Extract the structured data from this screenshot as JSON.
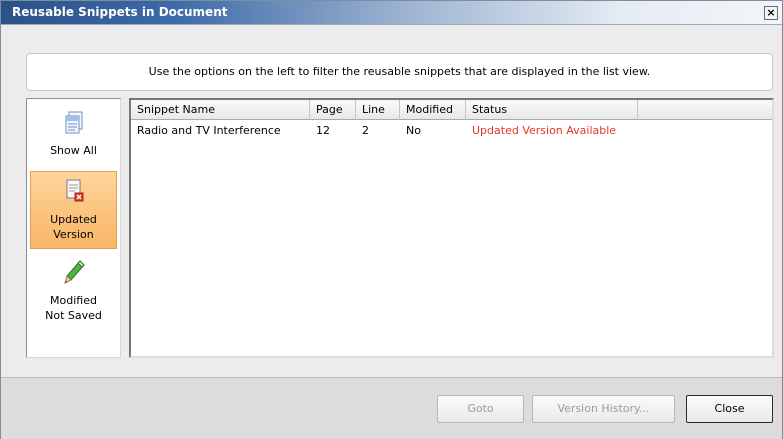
{
  "window": {
    "title": "Reusable Snippets in Document",
    "close_glyph": "×"
  },
  "info": {
    "text": "Use the options on the left to filter the reusable snippets that are displayed in the list view."
  },
  "filters": [
    {
      "label": "Show All",
      "icon": "document-stack-icon",
      "selected": false
    },
    {
      "label": "Updated\nVersion",
      "icon": "document-error-icon",
      "selected": true
    },
    {
      "label": "Modified\nNot Saved",
      "icon": "pencil-icon",
      "selected": false
    }
  ],
  "list": {
    "columns": [
      "Snippet Name",
      "Page",
      "Line",
      "Modified",
      "Status"
    ],
    "rows": [
      {
        "name": "Radio and TV Interference",
        "page": "12",
        "line": "2",
        "modified": "No",
        "status": "Updated Version Available"
      }
    ]
  },
  "buttons": {
    "goto": {
      "label": "Goto",
      "enabled": false
    },
    "version_history": {
      "label": "Version History...",
      "enabled": false
    },
    "close": {
      "label": "Close",
      "enabled": true
    }
  },
  "colors": {
    "status_alert": "#e8332a",
    "selected_filter": "#f8b566",
    "title_bar": "#2a5289"
  }
}
